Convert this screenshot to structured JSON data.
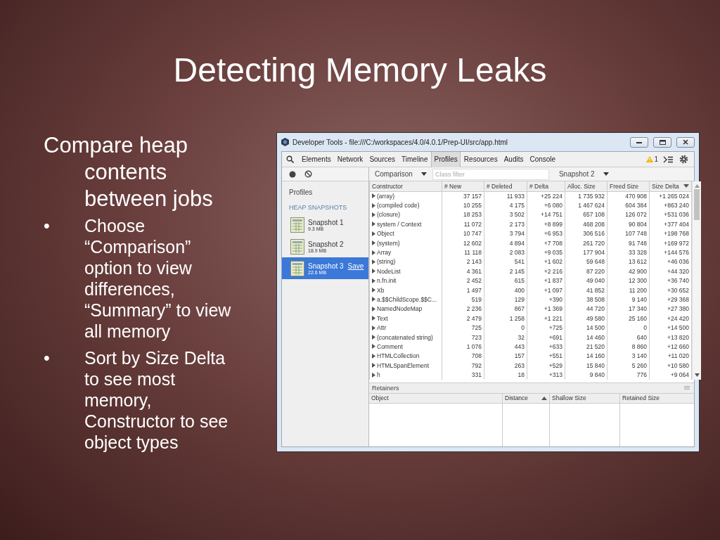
{
  "slide": {
    "title": "Detecting Memory Leaks",
    "intro": "Compare heap contents between jobs",
    "bullets": [
      {
        "marker": "•",
        "text": "Choose “Comparison” option to view differences, “Summary” to view all memory"
      },
      {
        "marker": "•",
        "text": "Sort by Size Delta to see most memory, Constructor to see object types"
      }
    ]
  },
  "devtools": {
    "title": "Developer Tools - file:///C:/workspaces/4.0/4.0.1/Prep-UI/src/app.html",
    "tabs": [
      {
        "label": "Elements",
        "selected": false
      },
      {
        "label": "Network",
        "selected": false
      },
      {
        "label": "Sources",
        "selected": false
      },
      {
        "label": "Timeline",
        "selected": false
      },
      {
        "label": "Profiles",
        "selected": true
      },
      {
        "label": "Resources",
        "selected": false
      },
      {
        "label": "Audits",
        "selected": false
      },
      {
        "label": "Console",
        "selected": false
      }
    ],
    "warning_count": "1",
    "view_select": "Comparison",
    "class_filter": {
      "placeholder": "Class filter"
    },
    "base_select": "Snapshot 2",
    "sidebar": {
      "title": "Profiles",
      "section": "HEAP SNAPSHOTS",
      "snapshots": [
        {
          "name": "Snapshot 1",
          "size": "9.3 MB",
          "selected": false
        },
        {
          "name": "Snapshot 2",
          "size": "18.9 MB",
          "selected": false
        },
        {
          "name": "Snapshot 3",
          "size": "22.6 MB",
          "selected": true,
          "action": "Save"
        }
      ]
    },
    "table": {
      "columns": [
        {
          "label": "Constructor",
          "sorted": false
        },
        {
          "label": "# New",
          "sorted": false
        },
        {
          "label": "# Deleted",
          "sorted": false
        },
        {
          "label": "# Delta",
          "sorted": false
        },
        {
          "label": "Alloc. Size",
          "sorted": false
        },
        {
          "label": "Freed Size",
          "sorted": false
        },
        {
          "label": "Size Delta",
          "sorted": true,
          "descending": true
        }
      ],
      "rows": [
        [
          "(array)",
          "37 157",
          "11 933",
          "+25 224",
          "1 735 932",
          "470 908",
          "+1 265 024"
        ],
        [
          "(compiled code)",
          "10 255",
          "4 175",
          "+6 080",
          "1 467 624",
          "604 384",
          "+863 240"
        ],
        [
          "(closure)",
          "18 253",
          "3 502",
          "+14 751",
          "657 108",
          "126 072",
          "+531 036"
        ],
        [
          "system / Context",
          "11 072",
          "2 173",
          "+8 899",
          "468 208",
          "90 804",
          "+377 404"
        ],
        [
          "Object",
          "10 747",
          "3 794",
          "+6 953",
          "306 516",
          "107 748",
          "+198 768"
        ],
        [
          "(system)",
          "12 602",
          "4 894",
          "+7 708",
          "261 720",
          "91 748",
          "+169 972"
        ],
        [
          "Array",
          "11 118",
          "2 083",
          "+9 035",
          "177 904",
          "33 328",
          "+144 576"
        ],
        [
          "(string)",
          "2 143",
          "541",
          "+1 602",
          "59 648",
          "13 612",
          "+46 036"
        ],
        [
          "NodeList",
          "4 361",
          "2 145",
          "+2 216",
          "87 220",
          "42 900",
          "+44 320"
        ],
        [
          "n.fn.init",
          "2 452",
          "615",
          "+1 837",
          "49 040",
          "12 300",
          "+36 740"
        ],
        [
          "Xb",
          "1 497",
          "400",
          "+1 097",
          "41 852",
          "11 200",
          "+30 652"
        ],
        [
          "a.$$ChildScope.$$C...",
          "519",
          "129",
          "+390",
          "38 508",
          "9 140",
          "+29 368"
        ],
        [
          "NamedNodeMap",
          "2 236",
          "867",
          "+1 369",
          "44 720",
          "17 340",
          "+27 380"
        ],
        [
          "Text",
          "2 479",
          "1 258",
          "+1 221",
          "49 580",
          "25 160",
          "+24 420"
        ],
        [
          "Attr",
          "725",
          "0",
          "+725",
          "14 500",
          "0",
          "+14 500"
        ],
        [
          "(concatenated string)",
          "723",
          "32",
          "+691",
          "14 460",
          "640",
          "+13 820"
        ],
        [
          "Comment",
          "1 076",
          "443",
          "+633",
          "21 520",
          "8 860",
          "+12 660"
        ],
        [
          "HTMLCollection",
          "708",
          "157",
          "+551",
          "14 160",
          "3 140",
          "+11 020"
        ],
        [
          "HTMLSpanElement",
          "792",
          "263",
          "+529",
          "15 840",
          "5 260",
          "+10 580"
        ],
        [
          "h",
          "331",
          "18",
          "+313",
          "9 840",
          "776",
          "+9 064"
        ]
      ]
    },
    "retainers": {
      "title": "Retainers",
      "columns": [
        {
          "label": "Object",
          "sorted": false
        },
        {
          "label": "Distance",
          "sorted": true,
          "descending": false
        },
        {
          "label": "Shallow Size",
          "sorted": false
        },
        {
          "label": "Retained Size",
          "sorted": false
        }
      ]
    }
  }
}
